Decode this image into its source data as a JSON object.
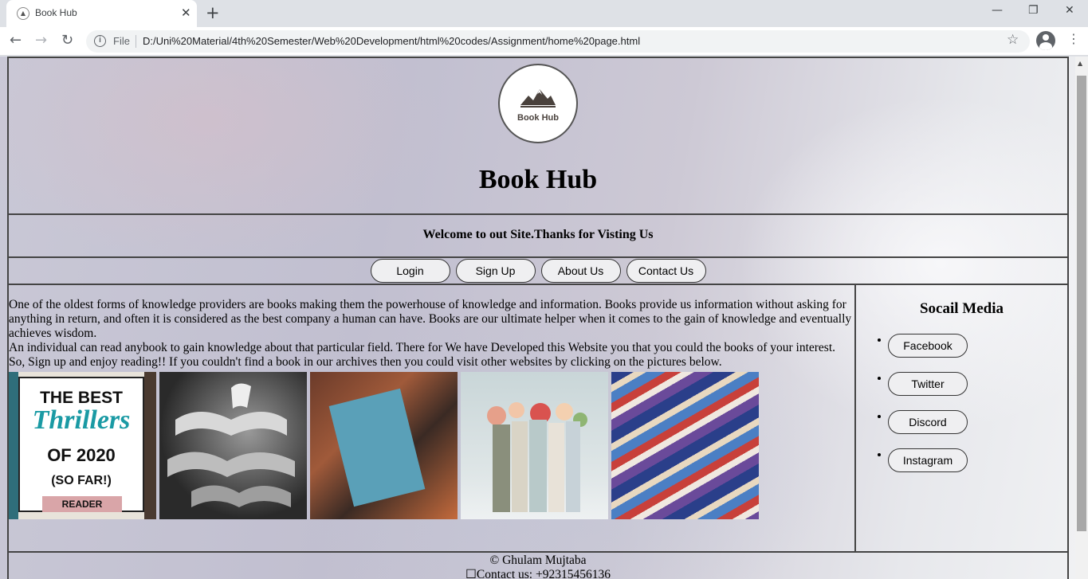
{
  "browser": {
    "tab_title": "Book Hub",
    "file_label": "File",
    "url": "D:/Uni%20Material/4th%20Semester/Web%20Development/html%20codes/Assignment/home%20page.html"
  },
  "header": {
    "logo_text": "Book Hub",
    "title": "Book Hub"
  },
  "welcome": "Welcome to out Site.Thanks for Visting Us",
  "nav": [
    "Login",
    "Sign Up",
    "About Us",
    "Contact Us"
  ],
  "content": {
    "para1": "One of the oldest forms of knowledge providers are books making them the powerhouse of knowledge and information. Books provide us information without asking for anything in return, and often it is considered as the best company a human can have. Books are our ultimate helper when it comes to the gain of knowledge and eventually achieves wisdom.",
    "para2": "An individual can read anybook to gain knowledge about that particular field. There for We have Developed this Website you that you could the books of your interest.",
    "para3": "So, Sign up and enjoy reading!! If you couldn't find a book in our archives then you could visit other websites by clicking on the pictures below.",
    "thumb1": {
      "line1": "THE BEST",
      "line2": "Thrillers",
      "line3": "OF 2020",
      "line4": "(SO FAR!)",
      "line5": "READER"
    }
  },
  "sidebar": {
    "title": "Socail Media",
    "links": [
      "Facebook",
      "Twitter",
      "Discord",
      "Instagram"
    ]
  },
  "footer": {
    "copyright": "© Ghulam Mujtaba",
    "contact": "Contact us: +92315456136"
  }
}
